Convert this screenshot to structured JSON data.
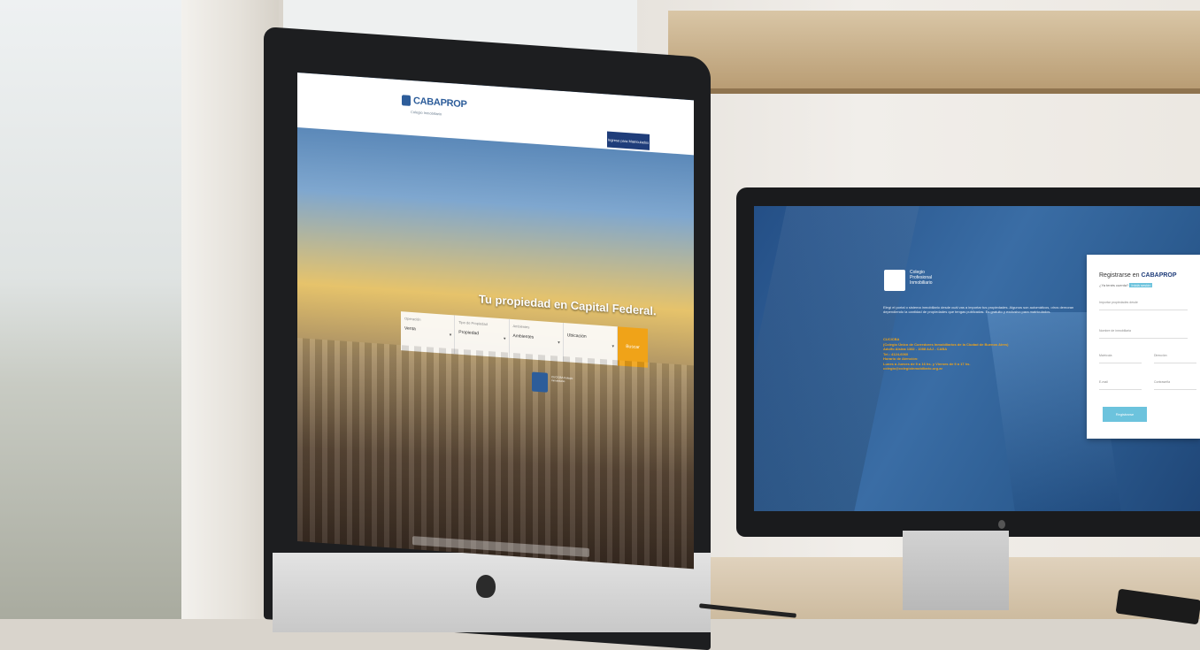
{
  "left_screen": {
    "brand": "CABAPROP",
    "brand_tagline": "Colegio Inmobiliario",
    "login_button": "Ingreso para Matriculados",
    "hero_title": "Tu propiedad en Capital Federal.",
    "search": {
      "fields": [
        {
          "label": "Operación",
          "value": "Venta"
        },
        {
          "label": "Tipo de Propiedad",
          "value": "Propiedad"
        },
        {
          "label": "Ambientes",
          "value": "Ambientes"
        },
        {
          "label": "",
          "value": "Ubicación"
        }
      ],
      "submit_label": "Buscar"
    },
    "badge_label": "CUCICBA Colegio Inmobiliario"
  },
  "right_screen": {
    "org_name": "Colegio Profesional Inmobiliario",
    "description": "Elegí el portal o sistema inmobiliario desde cuál vas a importar tus propiedades. Algunos son automáticos, otros demoran dependiendo la cantidad de propiedades que tengas publicadas. Es gratuito y exclusivo para matriculados.",
    "contact": "CUCICBA\n(Colegio Único de Corredores Inmobiliarios de la Ciudad de Buenos Aires)\nAdolfo Alsina 1382 - 1088 AAJ - CABA\nTel.: 4124-6060\nHorario de Atención:\nLunes a Jueves de 9 a 16 hs. y Viernes de 9 a 17 hs.\ncolegio@colegioinmobiliario.org.ar",
    "register": {
      "title_prefix": "Registrarse en ",
      "title_brand": "CABAPROP",
      "subtitle": "¿Ya tenés cuenta? ",
      "login_link": "Iniciá sesión",
      "fields": [
        "Importar propiedades desde",
        "Nombre de inmobiliaria",
        "Matrícula",
        "Dirección",
        "E-mail",
        "Contraseña"
      ],
      "submit_label": "Registrarse"
    }
  }
}
